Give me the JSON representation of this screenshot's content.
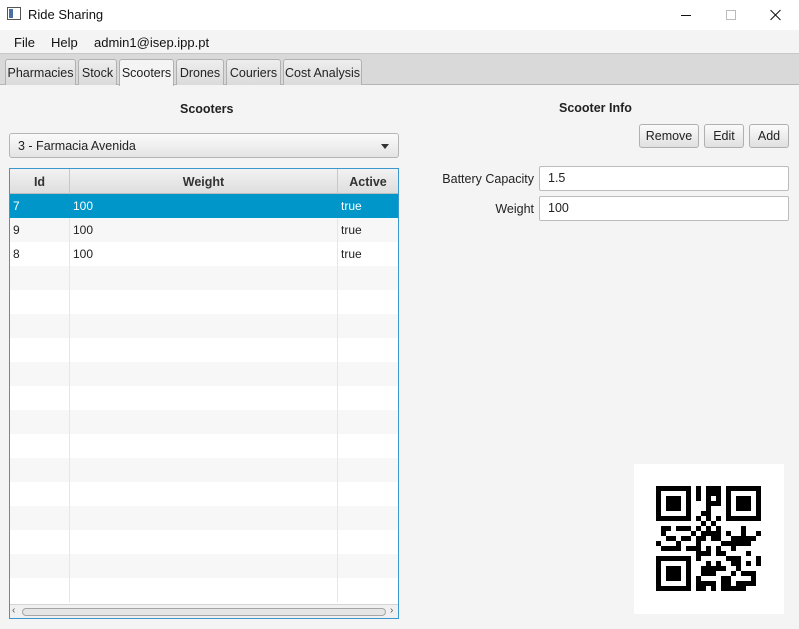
{
  "window": {
    "title": "Ride Sharing"
  },
  "menu": {
    "file": "File",
    "help": "Help",
    "user": "admin1@isep.ipp.pt"
  },
  "tabs": [
    "Pharmacies",
    "Stock",
    "Scooters",
    "Drones",
    "Couriers",
    "Cost Analysis"
  ],
  "active_tab": "Scooters",
  "scooters": {
    "title": "Scooters",
    "pharmacy_selected": "3 - Farmacia Avenida",
    "columns": [
      "Id",
      "Weight",
      "Active"
    ],
    "rows": [
      {
        "id": "7",
        "weight": "100",
        "active": "true",
        "selected": true
      },
      {
        "id": "9",
        "weight": "100",
        "active": "true",
        "selected": false
      },
      {
        "id": "8",
        "weight": "100",
        "active": "true",
        "selected": false
      }
    ]
  },
  "info": {
    "title": "Scooter Info",
    "buttons": {
      "remove": "Remove",
      "edit": "Edit",
      "add": "Add"
    },
    "battery_label": "Battery Capacity",
    "battery_value": "1.5",
    "weight_label": "Weight",
    "weight_value": "100"
  },
  "colors": {
    "selection": "#0096c9",
    "table_border": "#3a98cf"
  },
  "icons": {
    "app": "app-window-icon",
    "dropdown": "chevron-down-icon",
    "qr": "qr-code-image"
  }
}
